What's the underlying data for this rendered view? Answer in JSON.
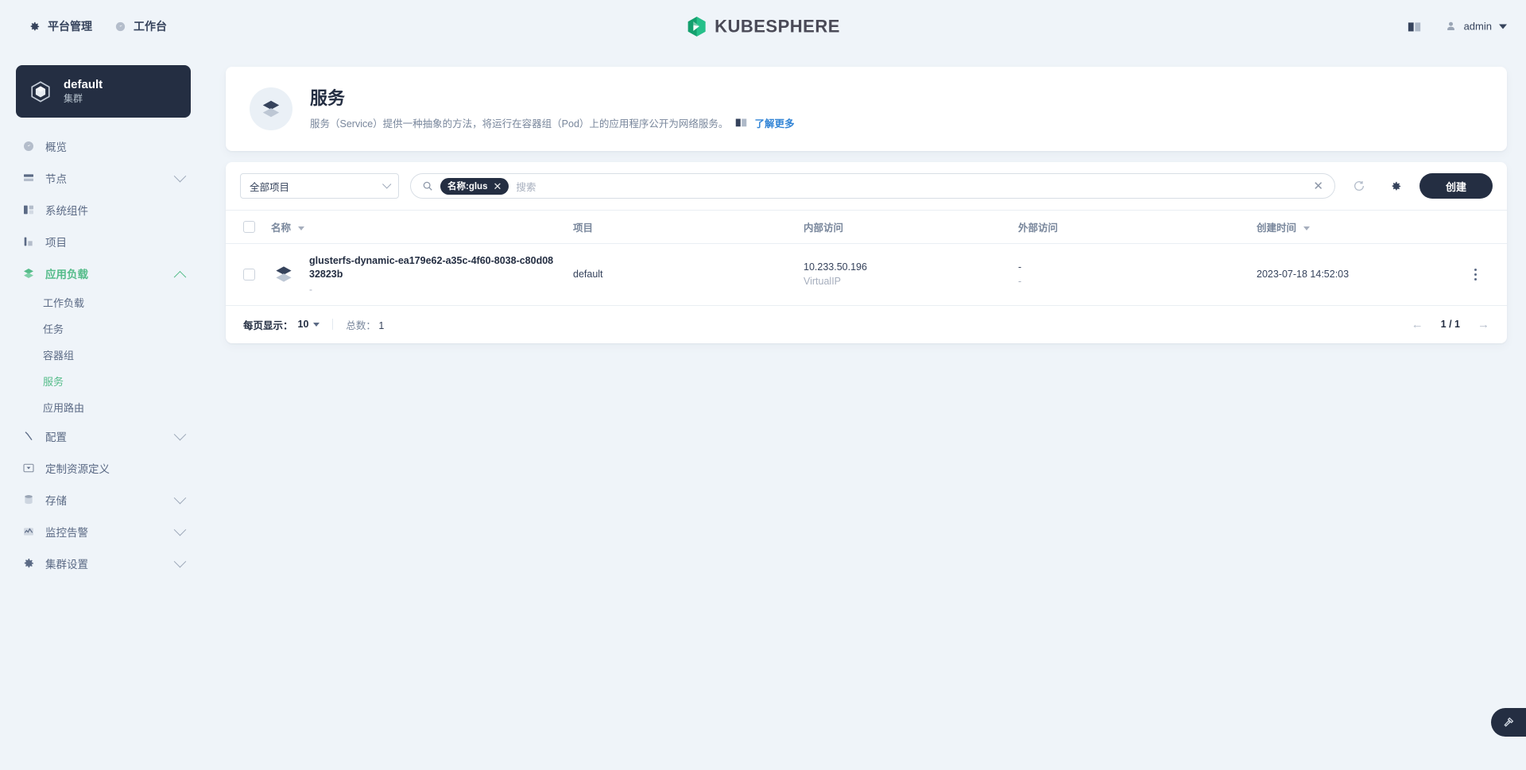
{
  "header": {
    "nav": [
      {
        "label": "平台管理",
        "icon": "gear-icon"
      },
      {
        "label": "工作台",
        "icon": "dashboard-icon"
      }
    ],
    "brand": "KUBESPHERE",
    "docs_icon": "book-icon",
    "user": "admin"
  },
  "sidebar": {
    "cluster": {
      "name": "default",
      "sub": "集群",
      "icon": "cube-icon"
    },
    "items": [
      {
        "label": "概览",
        "icon": "overview-icon",
        "expandable": false,
        "active": false
      },
      {
        "label": "节点",
        "icon": "node-icon",
        "expandable": true,
        "active": false
      },
      {
        "label": "系统组件",
        "icon": "components-icon",
        "expandable": false,
        "active": false
      },
      {
        "label": "项目",
        "icon": "project-icon",
        "expandable": false,
        "active": false
      },
      {
        "label": "应用负载",
        "icon": "workload-icon",
        "expandable": true,
        "active": true
      },
      {
        "label": "配置",
        "icon": "config-icon",
        "expandable": true,
        "active": false
      },
      {
        "label": "定制资源定义",
        "icon": "crd-icon",
        "expandable": false,
        "active": false
      },
      {
        "label": "存储",
        "icon": "storage-icon",
        "expandable": true,
        "active": false
      },
      {
        "label": "监控告警",
        "icon": "monitor-icon",
        "expandable": true,
        "active": false
      },
      {
        "label": "集群设置",
        "icon": "settings-icon",
        "expandable": true,
        "active": false
      }
    ],
    "submenu": [
      {
        "label": "工作负载",
        "active": false
      },
      {
        "label": "任务",
        "active": false
      },
      {
        "label": "容器组",
        "active": false
      },
      {
        "label": "服务",
        "active": true
      },
      {
        "label": "应用路由",
        "active": false
      }
    ]
  },
  "banner": {
    "title": "服务",
    "description": "服务（Service）提供一种抽象的方法，将运行在容器组（Pod）上的应用程序公开为网络服务。",
    "link": "了解更多",
    "link_icon": "book-icon",
    "icon": "service-icon"
  },
  "toolbar": {
    "project_filter": "全部项目",
    "search_icon": "search-icon",
    "search_tag": "名称:glus",
    "search_placeholder": "搜索",
    "clear_icon": "close-icon",
    "refresh_icon": "refresh-icon",
    "settings_icon": "gear-icon",
    "create_label": "创建"
  },
  "table": {
    "columns": [
      {
        "label": "名称",
        "sortable": true
      },
      {
        "label": "项目",
        "sortable": false
      },
      {
        "label": "内部访问",
        "sortable": false
      },
      {
        "label": "外部访问",
        "sortable": false
      },
      {
        "label": "创建时间",
        "sortable": true
      }
    ],
    "rows": [
      {
        "icon": "service-icon",
        "name": "glusterfs-dynamic-ea179e62-a35c-4f60-8038-c80d0832823b",
        "name_sub": "-",
        "project": "default",
        "internal_ip": "10.233.50.196",
        "internal_type": "VirtualIP",
        "external_line1": "-",
        "external_line2": "-",
        "created": "2023-07-18 14:52:03",
        "more_icon": "more-vertical-icon"
      }
    ]
  },
  "pagination": {
    "per_page_label": "每页显示：",
    "per_page_value": "10",
    "total_label": "总数：",
    "total_value": "1",
    "prev_icon": "arrow-left-icon",
    "next_icon": "arrow-right-icon",
    "page_indicator": "1 / 1"
  },
  "fab": {
    "icon": "hammer-icon"
  },
  "colors": {
    "accent_green": "#55bc8a",
    "dark_navy": "#242e42",
    "page_bg": "#eff4f9",
    "link_blue": "#3385d6"
  }
}
